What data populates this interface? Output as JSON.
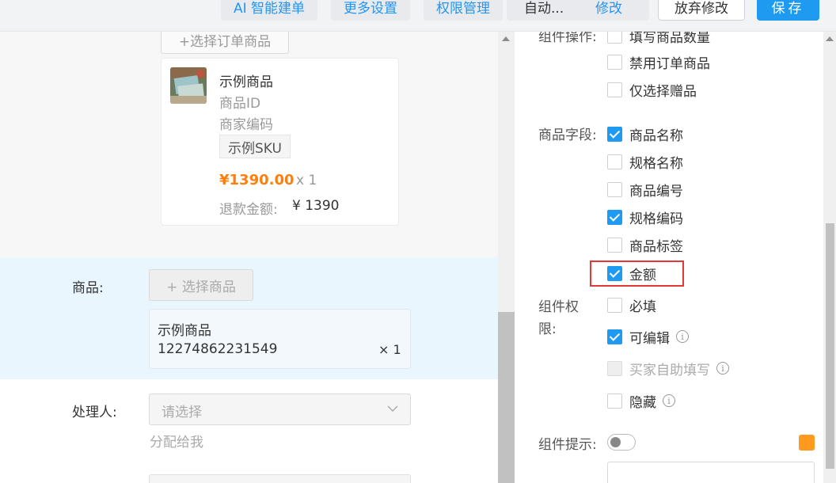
{
  "toolbar": {
    "ai_build": "AI 智能建单",
    "more_settings": "更多设置",
    "permissions": "权限管理",
    "auto_label": "自动...",
    "modify": "修改",
    "discard": "放弃修改",
    "save": "保存"
  },
  "preview": {
    "select_order_goods": "+选择订单商品",
    "order_item": {
      "name": "示例商品",
      "id_label": "商品ID",
      "merchant_code_label": "商家编码",
      "sku": "示例SKU",
      "price": "¥1390.00",
      "qty": "x 1",
      "refund_label": "退款金额:",
      "refund_value": "¥ 1390"
    },
    "product_label": "商品:",
    "select_product": "+ 选择商品",
    "product_item": {
      "name": "示例商品",
      "id": "12274862231549",
      "qty": "× 1"
    },
    "handler_label": "处理人:",
    "handler_placeholder": "请选择",
    "assign_to_me": "分配给我"
  },
  "panel": {
    "ops_label": "组件操作:",
    "ops_options": [
      {
        "label": "填写商品数量",
        "checked": false
      },
      {
        "label": "禁用订单商品",
        "checked": false
      },
      {
        "label": "仅选择赠品",
        "checked": false
      }
    ],
    "fields_label": "商品字段:",
    "field_options": [
      {
        "label": "商品名称",
        "checked": true
      },
      {
        "label": "规格名称",
        "checked": false
      },
      {
        "label": "商品编号",
        "checked": false
      },
      {
        "label": "规格编码",
        "checked": true
      },
      {
        "label": "商品标签",
        "checked": false
      },
      {
        "label": "金额",
        "checked": true
      }
    ],
    "perm_label_1": "组件权",
    "perm_label_2": "限:",
    "perm_options": [
      {
        "label": "必填",
        "checked": false,
        "disabled": false,
        "info": false
      },
      {
        "label": "可编辑",
        "checked": true,
        "disabled": false,
        "info": true
      },
      {
        "label": "买家自助填写",
        "checked": false,
        "disabled": true,
        "info": true
      },
      {
        "label": "隐藏",
        "checked": false,
        "disabled": false,
        "info": true
      }
    ],
    "hint_label": "组件提示:",
    "info_glyph": "i",
    "accent_color": "#1e9bf0",
    "highlight_color": "#e53935",
    "price_color": "#ff7f0e"
  }
}
